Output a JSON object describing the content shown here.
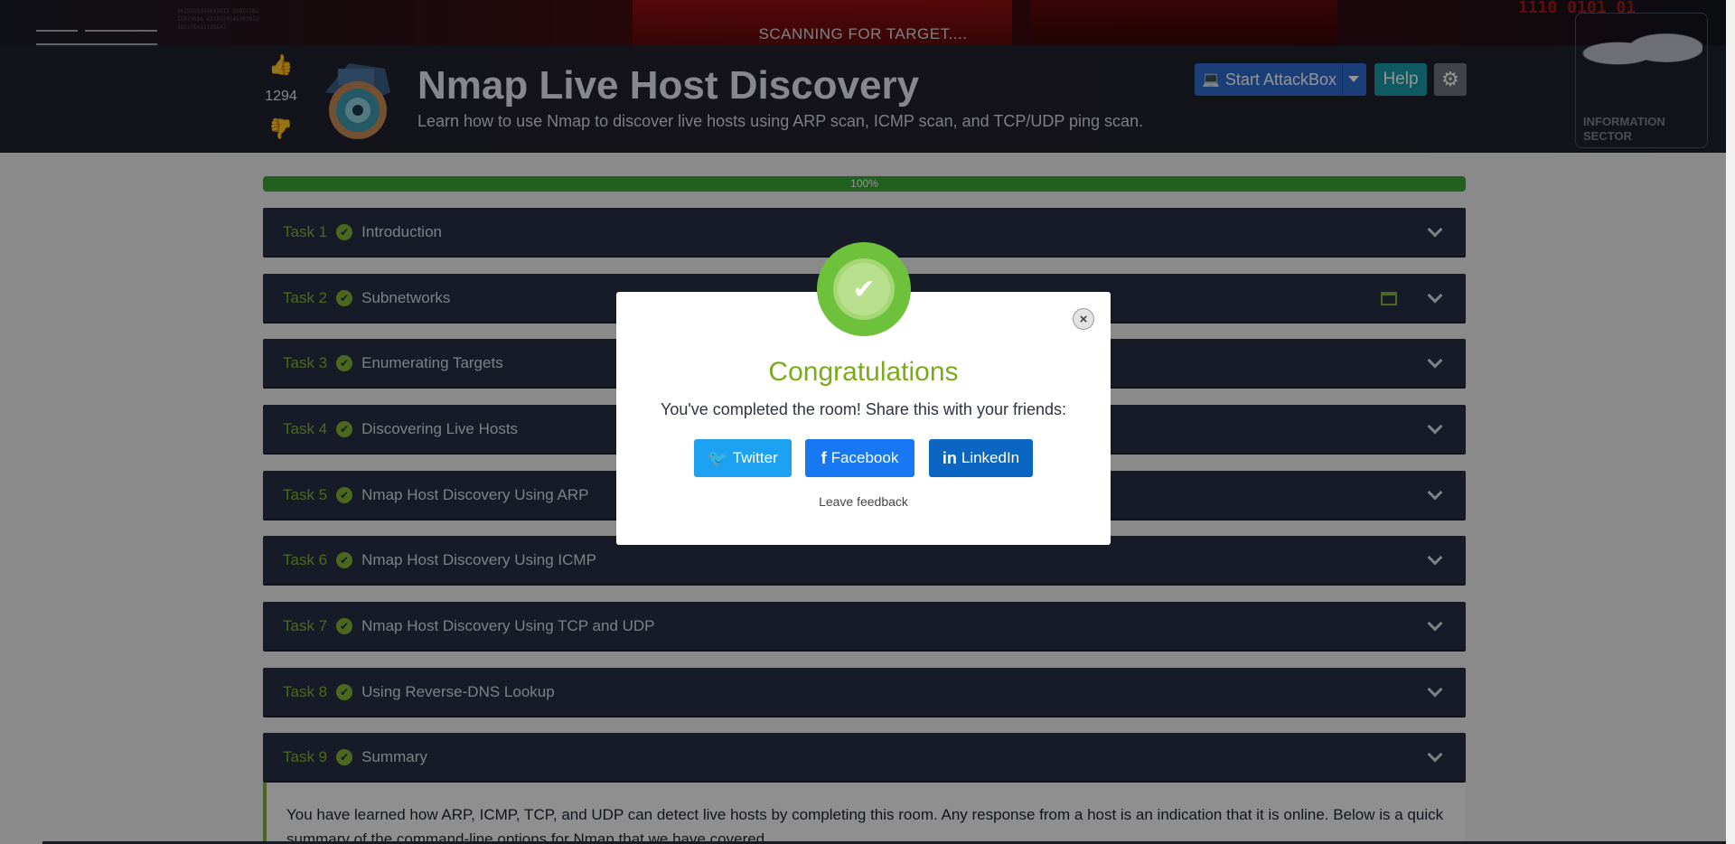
{
  "header": {
    "scanning_text": "SCANNING FOR TARGET....",
    "vote_count": "1294",
    "room_title": "Nmap Live Host Discovery",
    "room_description": "Learn how to use Nmap to discover live hosts using ARP scan, ICMP scan, and TCP/UDP ping scan.",
    "attackbox_label": "Start AttackBox",
    "help_label": "Help",
    "world_text": "INFORMATION SECTOR",
    "binary_code": "9615615615615615 6165156215615616 4216724545267852 385276+21725647",
    "red_code": "1110 0101 01"
  },
  "progress": {
    "label": "100%",
    "value": 1.0
  },
  "tasks": [
    {
      "num": "Task 1",
      "name": "Introduction"
    },
    {
      "num": "Task 2",
      "name": "Subnetworks"
    },
    {
      "num": "Task 3",
      "name": "Enumerating Targets"
    },
    {
      "num": "Task 4",
      "name": "Discovering Live Hosts"
    },
    {
      "num": "Task 5",
      "name": "Nmap Host Discovery Using ARP"
    },
    {
      "num": "Task 6",
      "name": "Nmap Host Discovery Using ICMP"
    },
    {
      "num": "Task 7",
      "name": "Nmap Host Discovery Using TCP and UDP"
    },
    {
      "num": "Task 8",
      "name": "Using Reverse-DNS Lookup"
    },
    {
      "num": "Task 9",
      "name": "Summary"
    }
  ],
  "summary_text": "You have learned how ARP, ICMP, TCP, and UDP can detect live hosts by completing this room. Any response from a host is an indication that it is online. Below is a quick summary of the command-line options for Nmap that we have covered.",
  "modal": {
    "title": "Congratulations",
    "message": "You've completed the room! Share this with your friends:",
    "twitter": "Twitter",
    "facebook": "Facebook",
    "linkedin": "LinkedIn",
    "feedback": "Leave feedback"
  },
  "colors": {
    "task_bg": "#272f44",
    "accent_green": "#83b335",
    "twitter": "#1da1f2",
    "facebook": "#1877f2",
    "linkedin": "#0a66c2"
  }
}
